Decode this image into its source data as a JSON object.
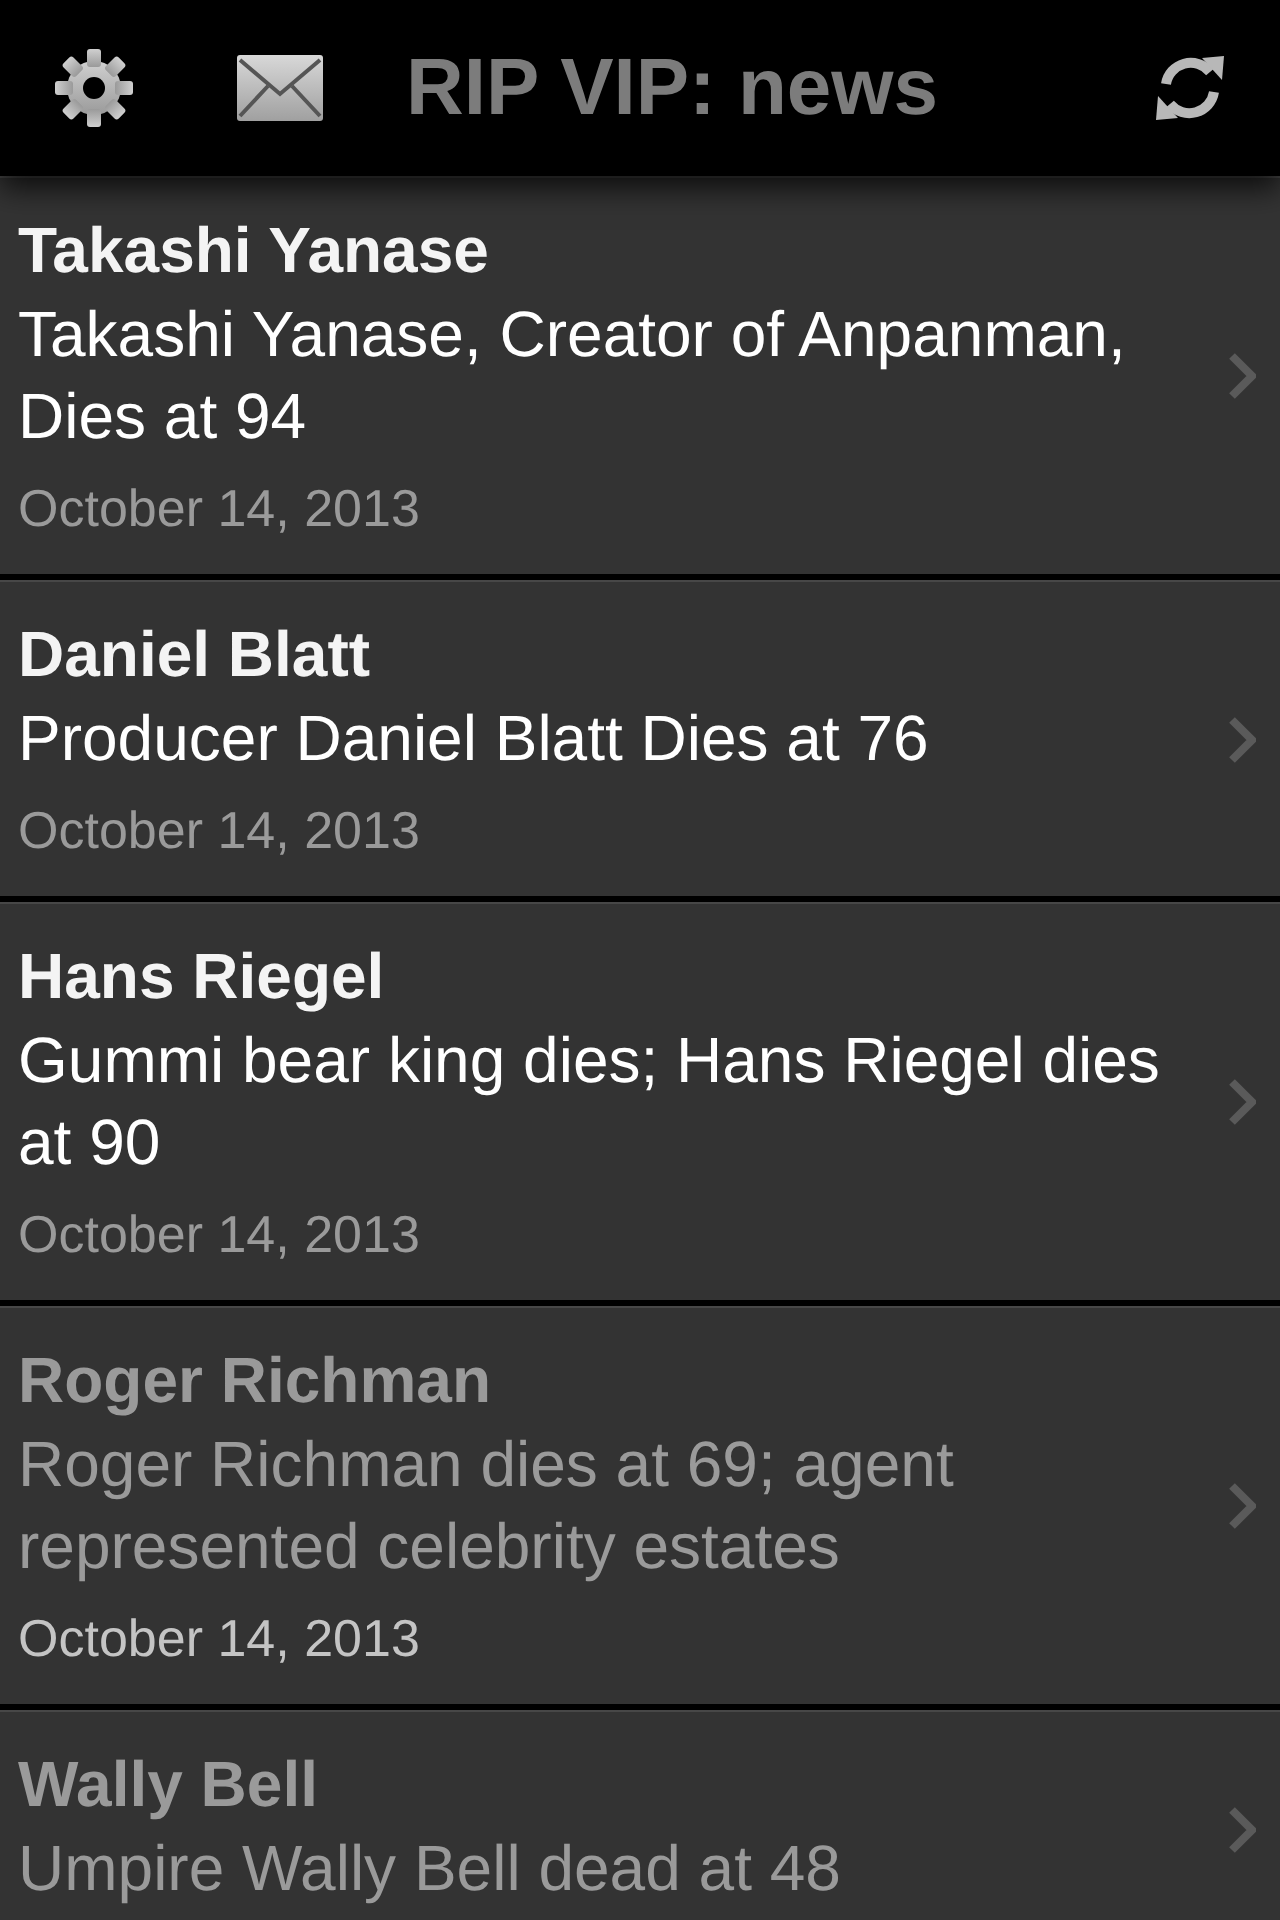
{
  "header": {
    "title": "RIP VIP: news"
  },
  "articles": [
    {
      "name": "Takashi Yanase",
      "headline": "Takashi Yanase, Creator of Anpanman, Dies at 94",
      "date": "October 14, 2013",
      "read": false
    },
    {
      "name": "Daniel Blatt",
      "headline": "Producer Daniel Blatt Dies at 76",
      "date": "October 14, 2013",
      "read": false
    },
    {
      "name": "Hans Riegel",
      "headline": "Gummi bear king dies; Hans Riegel dies at 90",
      "date": "October 14, 2013",
      "read": false
    },
    {
      "name": "Roger Richman",
      "headline": "Roger Richman dies at 69; agent represented celebrity estates",
      "date": "October 14, 2013",
      "read": true
    },
    {
      "name": "Wally Bell",
      "headline": "Umpire Wally Bell dead at 48",
      "read": true
    }
  ]
}
